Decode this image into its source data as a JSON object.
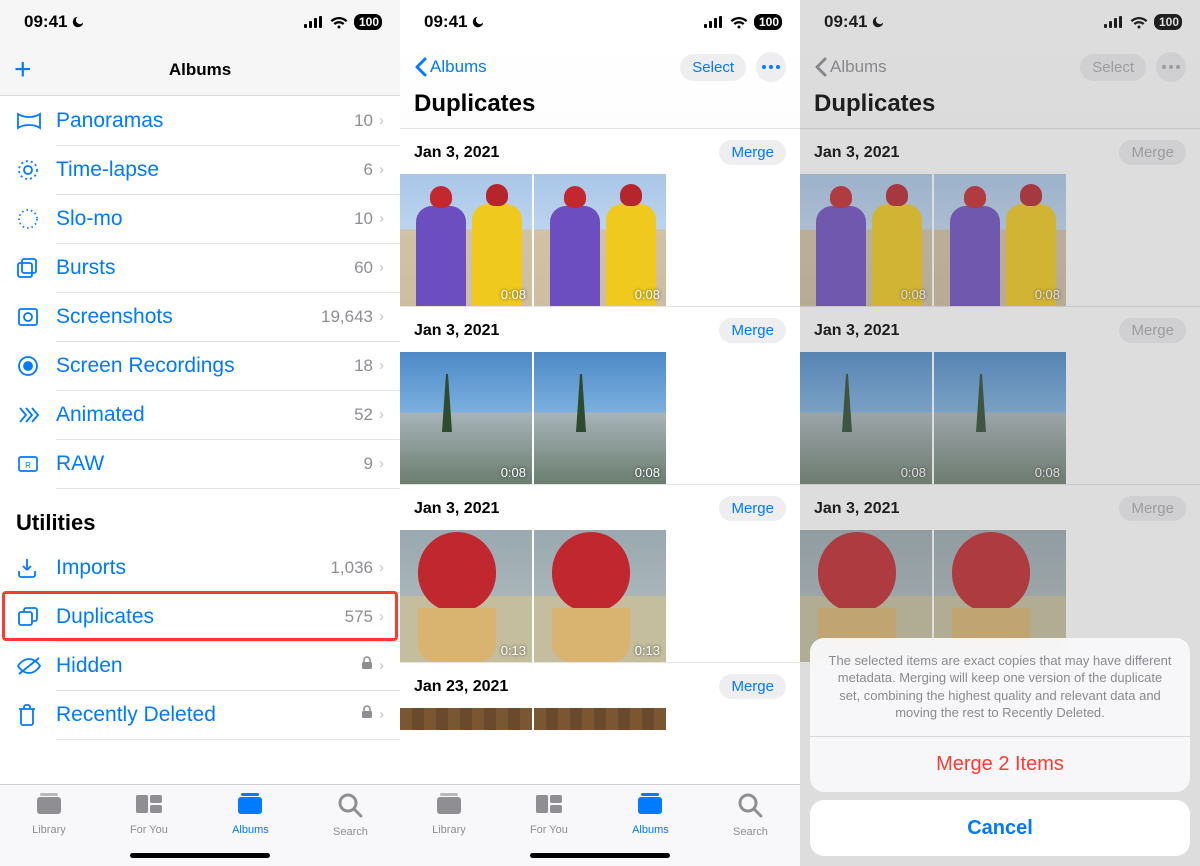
{
  "status": {
    "time": "09:41",
    "battery": "100"
  },
  "screen1": {
    "nav": {
      "title": "Albums",
      "add_label": "+"
    },
    "rows": [
      {
        "icon": "panorama",
        "label": "Panoramas",
        "count": "10"
      },
      {
        "icon": "timelapse",
        "label": "Time-lapse",
        "count": "6"
      },
      {
        "icon": "slomo",
        "label": "Slo-mo",
        "count": "10"
      },
      {
        "icon": "bursts",
        "label": "Bursts",
        "count": "60"
      },
      {
        "icon": "screenshots",
        "label": "Screenshots",
        "count": "19,643"
      },
      {
        "icon": "screenrec",
        "label": "Screen Recordings",
        "count": "18"
      },
      {
        "icon": "animated",
        "label": "Animated",
        "count": "52"
      },
      {
        "icon": "raw",
        "label": "RAW",
        "count": "9"
      }
    ],
    "section_utilities": "Utilities",
    "utilities": [
      {
        "icon": "imports",
        "label": "Imports",
        "count": "1,036",
        "locked": false
      },
      {
        "icon": "duplicates",
        "label": "Duplicates",
        "count": "575",
        "locked": false,
        "highlighted": true
      },
      {
        "icon": "hidden",
        "label": "Hidden",
        "count": "",
        "locked": true
      },
      {
        "icon": "trash",
        "label": "Recently Deleted",
        "count": "",
        "locked": true
      }
    ],
    "tabs": [
      {
        "label": "Library",
        "active": false
      },
      {
        "label": "For You",
        "active": false
      },
      {
        "label": "Albums",
        "active": true
      },
      {
        "label": "Search",
        "active": false
      }
    ]
  },
  "screen2": {
    "back_label": "Albums",
    "select_label": "Select",
    "title": "Duplicates",
    "merge_label": "Merge",
    "groups": [
      {
        "date": "Jan 3, 2021",
        "thumbs": [
          {
            "dur": "0:08",
            "kind": "people"
          },
          {
            "dur": "0:08",
            "kind": "people"
          }
        ]
      },
      {
        "date": "Jan 3, 2021",
        "thumbs": [
          {
            "dur": "0:08",
            "kind": "mtn"
          },
          {
            "dur": "0:08",
            "kind": "mtn"
          }
        ]
      },
      {
        "date": "Jan 3, 2021",
        "thumbs": [
          {
            "dur": "0:13",
            "kind": "hat"
          },
          {
            "dur": "0:13",
            "kind": "hat"
          }
        ]
      },
      {
        "date": "Jan 23, 2021",
        "thumbs": [
          {
            "dur": "",
            "kind": "wood"
          },
          {
            "dur": "",
            "kind": "wood"
          }
        ]
      }
    ],
    "tabs": [
      {
        "label": "Library",
        "active": false
      },
      {
        "label": "For You",
        "active": false
      },
      {
        "label": "Albums",
        "active": true
      },
      {
        "label": "Search",
        "active": false
      }
    ]
  },
  "screen3": {
    "back_label": "Albums",
    "select_label": "Select",
    "title": "Duplicates",
    "merge_label": "Merge",
    "groups": [
      {
        "date": "Jan 3, 2021",
        "thumbs": [
          {
            "dur": "0:08",
            "kind": "people"
          },
          {
            "dur": "0:08",
            "kind": "people"
          }
        ]
      },
      {
        "date": "Jan 3, 2021",
        "thumbs": [
          {
            "dur": "0:08",
            "kind": "mtn"
          },
          {
            "dur": "0:08",
            "kind": "mtn"
          }
        ]
      },
      {
        "date": "Jan 3, 2021",
        "thumbs": [
          {
            "dur": "",
            "kind": "hat"
          },
          {
            "dur": "",
            "kind": "hat"
          }
        ]
      }
    ],
    "sheet": {
      "message": "The selected items are exact copies that may have different metadata. Merging will keep one version of the duplicate set, combining the highest quality and relevant data and moving the rest to Recently Deleted.",
      "merge_label": "Merge 2 Items",
      "cancel_label": "Cancel"
    }
  }
}
